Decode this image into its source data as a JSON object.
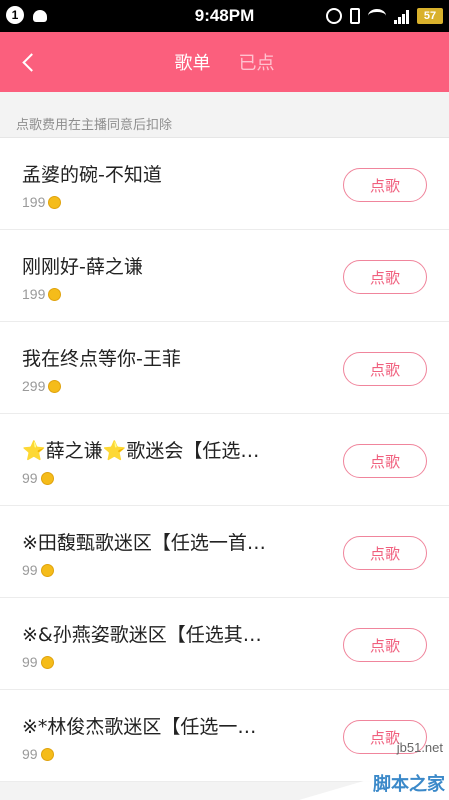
{
  "status_bar": {
    "left_badge": "1",
    "time": "9:48PM",
    "battery": "57"
  },
  "header": {
    "tabs": [
      {
        "label": "歌单",
        "active": true
      },
      {
        "label": "已点",
        "active": false
      }
    ]
  },
  "hint": "点歌费用在主播同意后扣除",
  "songs": [
    {
      "title": "孟婆的碗-不知道",
      "price": "199",
      "button": "点歌"
    },
    {
      "title": "刚刚好-薛之谦",
      "price": "199",
      "button": "点歌"
    },
    {
      "title": "我在终点等你-王菲",
      "price": "299",
      "button": "点歌"
    },
    {
      "title": "⭐薛之谦⭐歌迷会【任选…",
      "price": "99",
      "button": "点歌"
    },
    {
      "title": "※田馥甄歌迷区【任选一首…",
      "price": "99",
      "button": "点歌"
    },
    {
      "title": "※&孙燕姿歌迷区【任选其…",
      "price": "99",
      "button": "点歌"
    },
    {
      "title": "※*林俊杰歌迷区【任选一…",
      "price": "99",
      "button": "点歌"
    }
  ],
  "watermark": {
    "url": "jb51.net",
    "name": "脚本之家"
  },
  "colors": {
    "accent": "#fb5f7d",
    "button": "#f0607e",
    "coin": "#f5bc1a"
  }
}
